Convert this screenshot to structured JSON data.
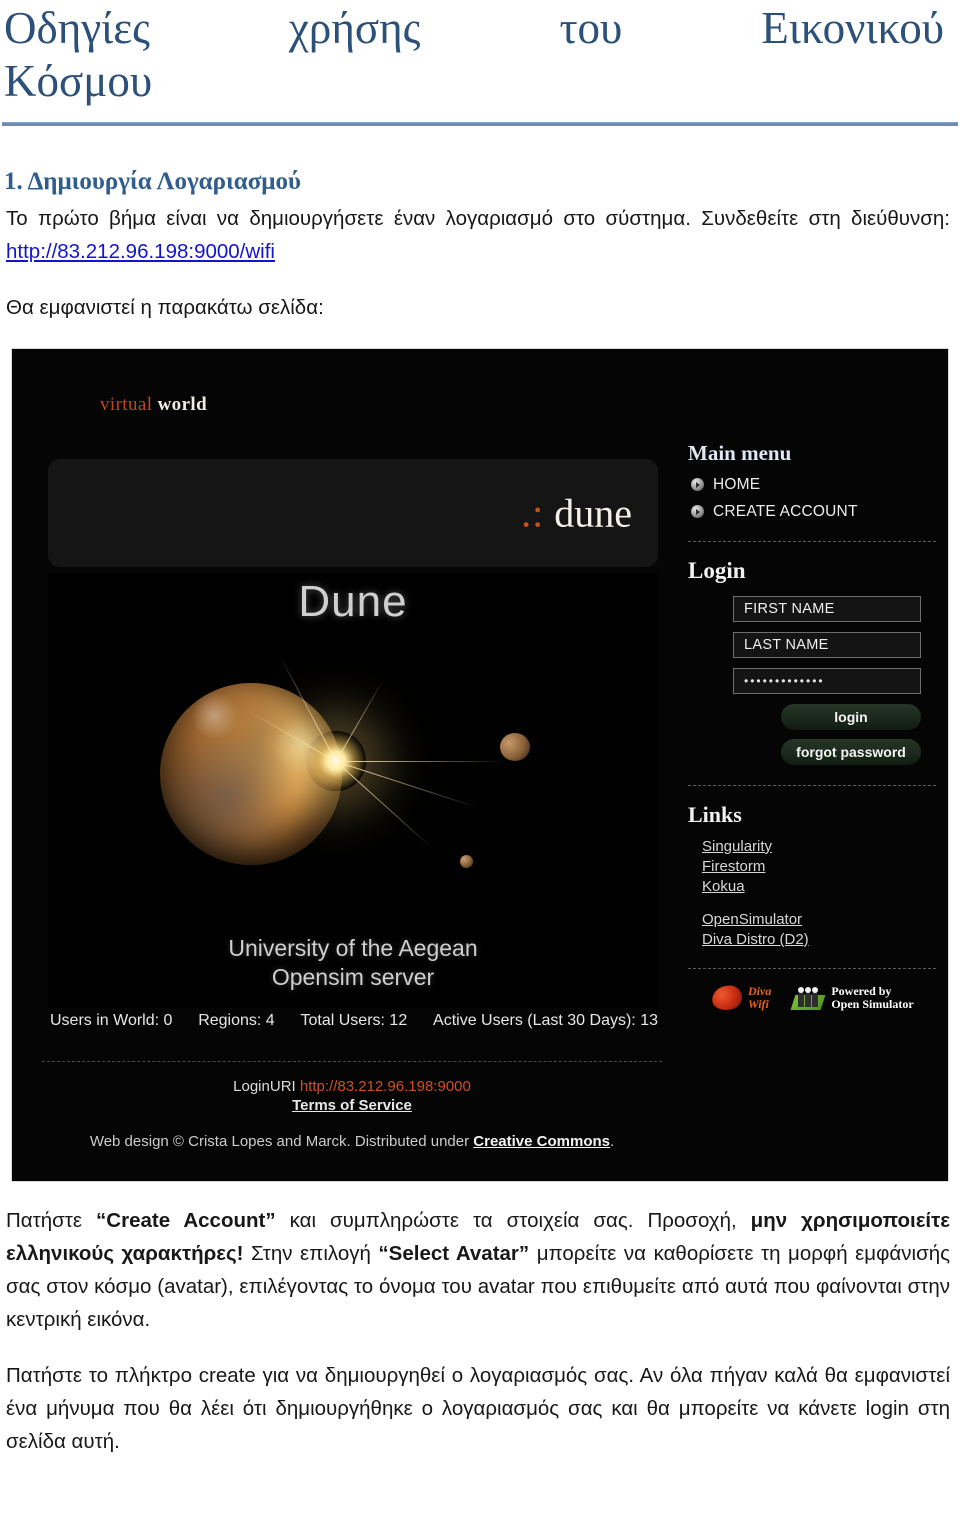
{
  "document": {
    "title_line1": "Οδηγίες χρήσης του Εικονικού",
    "title_line2": "Κόσμου",
    "section_heading": "1. Δημιουργία Λογαριασμού",
    "para1_a": "Το πρώτο βήμα είναι να δημιουργήσετε έναν λογαριασμό στο σύστημα. Συνδεθείτε στη διεύθυνση: ",
    "para1_link": "http://83.212.96.198:9000/wifi",
    "para2": "Θα εμφανιστεί η παρακάτω σελίδα:",
    "para3_full": "Πατήστε “Create Account” και συμπληρώστε τα στοιχεία σας. Προσοχή, μην χρησιμοποιείτε ελληνικούς χαρακτήρες! Στην επιλογή “Select Avatar” μπορείτε να καθορίσετε τη μορφή εμφάνισής σας στον κόσμο (avatar), επιλέγοντας το όνομα του avatar που επιθυμείτε από αυτά  που φαίνονται στην κεντρική εικόνα.",
    "para3_seg1": "Πατήστε ",
    "para3_bold1": "“Create Account”",
    "para3_seg2": " και συμπληρώστε τα στοιχεία σας. Προσοχή, ",
    "para3_bold2": "μην χρησιμοποιείτε ελληνικούς χαρακτήρες!",
    "para3_seg3": " Στην επιλογή ",
    "para3_bold3": "“Select Avatar”",
    "para3_seg4": " μπορείτε να καθορίσετε τη μορφή εμφάνισής σας στον κόσμο (avatar), επιλέγοντας το όνομα του avatar που επιθυμείτε από αυτά  που φαίνονται στην κεντρική εικόνα.",
    "para4": "Πατήστε το πλήκτρο create για να δημιουργηθεί ο λογαριασμός σας. Αν όλα πήγαν καλά θα εμφανιστεί ένα μήνυμα που θα λέει ότι δημιουργήθηκε ο λογαριασμός σας και θα μπορείτε να κάνετε login στη σελίδα αυτή.",
    "title_color": "#2b5079",
    "heading_color": "#2e5d8e",
    "rule_color": "#6b8bb5",
    "link_color": "#1414cf"
  },
  "screenshot": {
    "logo": {
      "word1": "virtual",
      "word2": "world",
      "word1_color": "#c5461b",
      "word2_color": "#f0ece6"
    },
    "banner": {
      "dots": ".:",
      "text": "dune",
      "dots_color": "#c8521e"
    },
    "hero": {
      "title": "Dune",
      "subtitle_line1": "University of the Aegean",
      "subtitle_line2": "Opensim server"
    },
    "stats": [
      "Users in World: 0",
      "Regions: 4",
      "Total Users: 12",
      "Active Users (Last 30 Days): 13"
    ],
    "sidebar": {
      "main_menu_heading": "Main menu",
      "menu_items": [
        {
          "label": "HOME"
        },
        {
          "label": "CREATE ACCOUNT"
        }
      ],
      "login_heading": "Login",
      "first_name_value": "FIRST NAME",
      "last_name_value": "LAST NAME",
      "password_value": "•••••••••••••",
      "login_button": "login",
      "forgot_button": "forgot password",
      "links_heading": "Links",
      "links_group1": [
        {
          "label": "Singularity"
        },
        {
          "label": "Firestorm"
        },
        {
          "label": "Kokua"
        }
      ],
      "links_group2": [
        {
          "label": "OpenSimulator"
        },
        {
          "label": "Diva Distro (D2)"
        }
      ],
      "badges": [
        {
          "line1": "Diva",
          "line2": "Wifi"
        },
        {
          "line1": "Powered by",
          "line2": "Open Simulator"
        }
      ]
    },
    "footer": {
      "loginuri_label": "LoginURI ",
      "loginuri_value": "http://83.212.96.198:9000",
      "loginuri_color": "#cf4f24",
      "terms_of_service": "Terms of Service",
      "credit_prefix": "Web design © Crista Lopes and Marck. Distributed under ",
      "credit_link": "Creative Commons",
      "credit_suffix": "."
    }
  }
}
